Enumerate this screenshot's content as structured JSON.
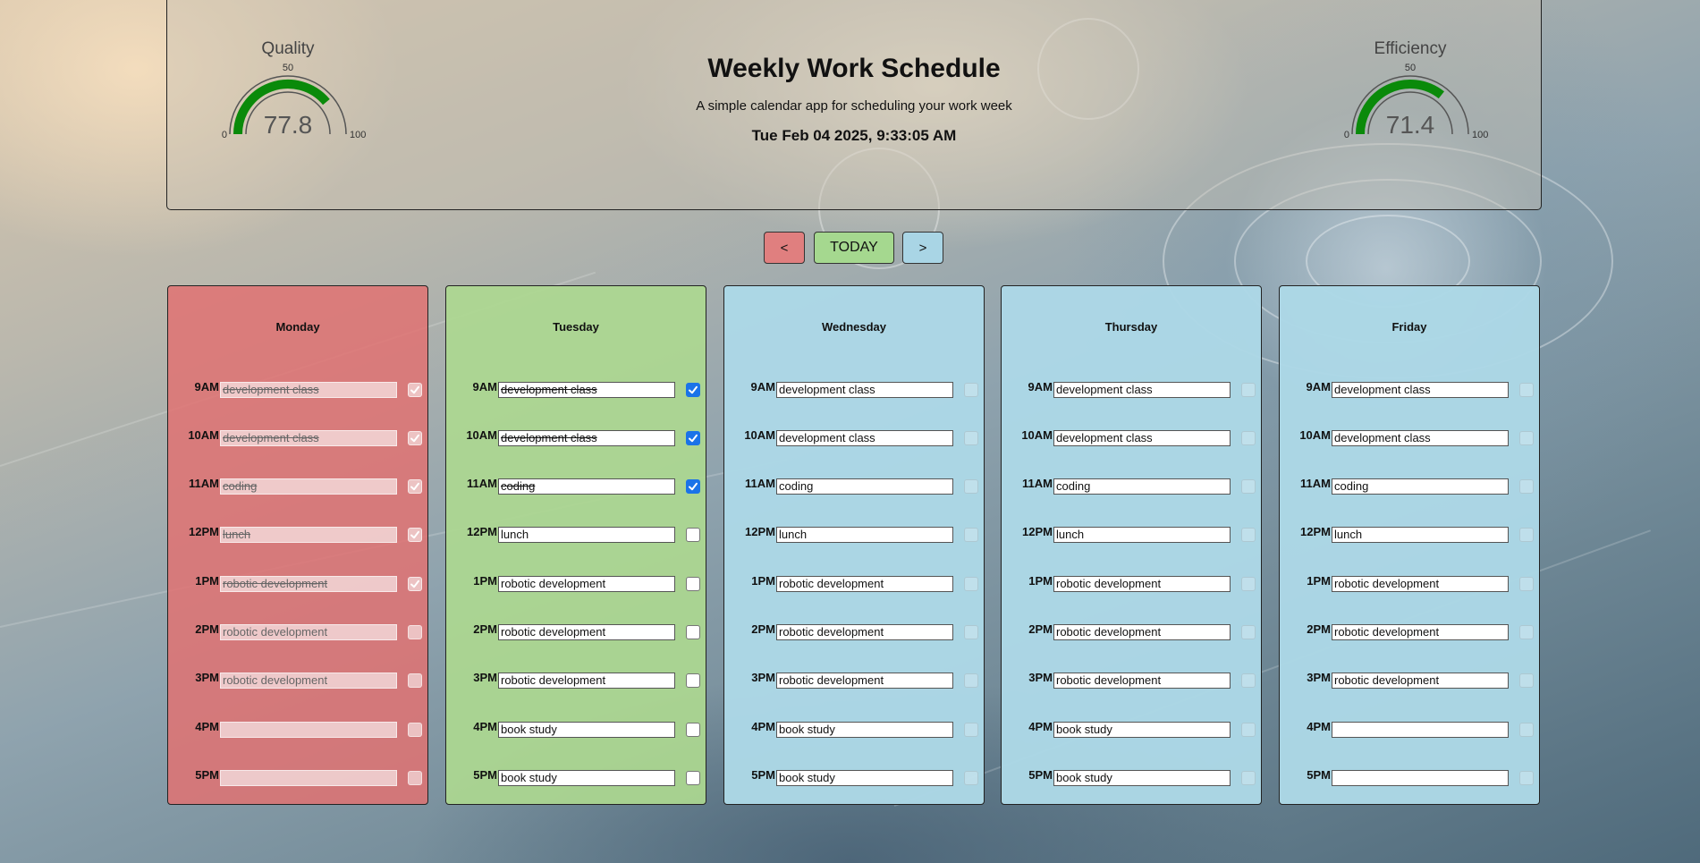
{
  "header": {
    "title": "Weekly Work Schedule",
    "subtitle": "A simple calendar app for scheduling your work week",
    "datetime": "Tue Feb 04 2025, 9:33:05 AM"
  },
  "gauges": {
    "quality": {
      "label": "Quality",
      "value": "77.8",
      "min": "0",
      "mid": "50",
      "max": "100",
      "fraction": 0.778
    },
    "efficiency": {
      "label": "Efficiency",
      "value": "71.4",
      "min": "0",
      "mid": "50",
      "max": "100",
      "fraction": 0.714
    }
  },
  "nav": {
    "prev_label": "<",
    "today_label": "TODAY",
    "next_label": ">"
  },
  "colors": {
    "past": "#e07272",
    "today": "#acd890",
    "future": "#acd8e6",
    "gauge_fill": "#0a8a0a",
    "checkbox": "#1a73e8"
  },
  "days": [
    {
      "name": "Monday",
      "slots": [
        {
          "time": "9AM",
          "task": "development class",
          "done": true
        },
        {
          "time": "10AM",
          "task": "development class",
          "done": true
        },
        {
          "time": "11AM",
          "task": "coding",
          "done": true
        },
        {
          "time": "12PM",
          "task": "lunch",
          "done": true
        },
        {
          "time": "1PM",
          "task": "robotic development",
          "done": true
        },
        {
          "time": "2PM",
          "task": "robotic development",
          "done": false
        },
        {
          "time": "3PM",
          "task": "robotic development",
          "done": false
        },
        {
          "time": "4PM",
          "task": "",
          "done": false
        },
        {
          "time": "5PM",
          "task": "",
          "done": false
        }
      ]
    },
    {
      "name": "Tuesday",
      "slots": [
        {
          "time": "9AM",
          "task": "development class",
          "done": true
        },
        {
          "time": "10AM",
          "task": "development class",
          "done": true
        },
        {
          "time": "11AM",
          "task": "coding",
          "done": true
        },
        {
          "time": "12PM",
          "task": "lunch",
          "done": false
        },
        {
          "time": "1PM",
          "task": "robotic development",
          "done": false
        },
        {
          "time": "2PM",
          "task": "robotic development",
          "done": false
        },
        {
          "time": "3PM",
          "task": "robotic development",
          "done": false
        },
        {
          "time": "4PM",
          "task": "book study",
          "done": false
        },
        {
          "time": "5PM",
          "task": "book study",
          "done": false
        }
      ]
    },
    {
      "name": "Wednesday",
      "slots": [
        {
          "time": "9AM",
          "task": "development class",
          "done": false
        },
        {
          "time": "10AM",
          "task": "development class",
          "done": false
        },
        {
          "time": "11AM",
          "task": "coding",
          "done": false
        },
        {
          "time": "12PM",
          "task": "lunch",
          "done": false
        },
        {
          "time": "1PM",
          "task": "robotic development",
          "done": false
        },
        {
          "time": "2PM",
          "task": "robotic development",
          "done": false
        },
        {
          "time": "3PM",
          "task": "robotic development",
          "done": false
        },
        {
          "time": "4PM",
          "task": "book study",
          "done": false
        },
        {
          "time": "5PM",
          "task": "book study",
          "done": false
        }
      ]
    },
    {
      "name": "Thursday",
      "slots": [
        {
          "time": "9AM",
          "task": "development class",
          "done": false
        },
        {
          "time": "10AM",
          "task": "development class",
          "done": false
        },
        {
          "time": "11AM",
          "task": "coding",
          "done": false
        },
        {
          "time": "12PM",
          "task": "lunch",
          "done": false
        },
        {
          "time": "1PM",
          "task": "robotic development",
          "done": false
        },
        {
          "time": "2PM",
          "task": "robotic development",
          "done": false
        },
        {
          "time": "3PM",
          "task": "robotic development",
          "done": false
        },
        {
          "time": "4PM",
          "task": "book study",
          "done": false
        },
        {
          "time": "5PM",
          "task": "book study",
          "done": false
        }
      ]
    },
    {
      "name": "Friday",
      "slots": [
        {
          "time": "9AM",
          "task": "development class",
          "done": false
        },
        {
          "time": "10AM",
          "task": "development class",
          "done": false
        },
        {
          "time": "11AM",
          "task": "coding",
          "done": false
        },
        {
          "time": "12PM",
          "task": "lunch",
          "done": false
        },
        {
          "time": "1PM",
          "task": "robotic development",
          "done": false
        },
        {
          "time": "2PM",
          "task": "robotic development",
          "done": false
        },
        {
          "time": "3PM",
          "task": "robotic development",
          "done": false
        },
        {
          "time": "4PM",
          "task": "",
          "done": false
        },
        {
          "time": "5PM",
          "task": "",
          "done": false
        }
      ]
    }
  ]
}
